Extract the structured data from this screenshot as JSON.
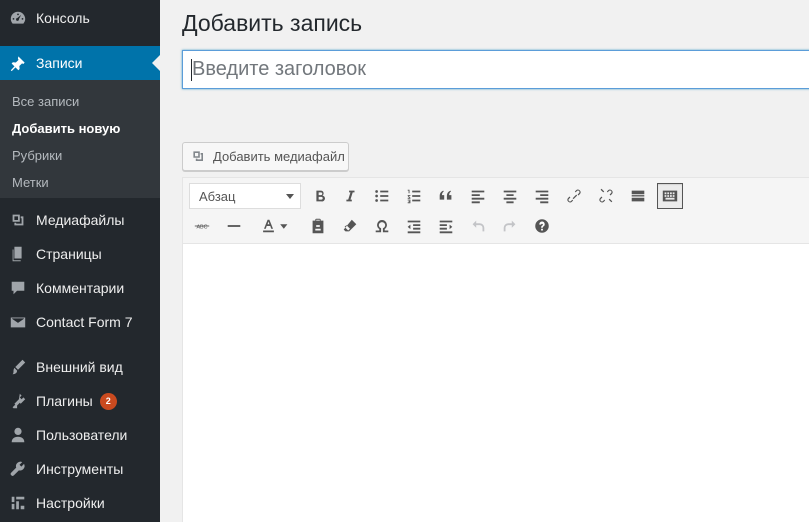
{
  "sidebar": {
    "items": [
      {
        "label": "Консоль",
        "icon": "dashboard-icon"
      },
      {
        "label": "Записи",
        "icon": "pin-icon",
        "active": true
      },
      {
        "label": "Медиафайлы",
        "icon": "media-icon"
      },
      {
        "label": "Страницы",
        "icon": "pages-icon"
      },
      {
        "label": "Комментарии",
        "icon": "comments-icon"
      },
      {
        "label": "Contact Form 7",
        "icon": "mail-icon"
      },
      {
        "label": "Внешний вид",
        "icon": "brush-icon"
      },
      {
        "label": "Плагины",
        "icon": "plugins-icon",
        "badge": "2"
      },
      {
        "label": "Пользователи",
        "icon": "users-icon"
      },
      {
        "label": "Инструменты",
        "icon": "wrench-icon"
      },
      {
        "label": "Настройки",
        "icon": "settings-icon"
      }
    ],
    "submenu": [
      {
        "label": "Все записи"
      },
      {
        "label": "Добавить новую",
        "current": true
      },
      {
        "label": "Рубрики"
      },
      {
        "label": "Метки"
      }
    ]
  },
  "main": {
    "page_title": "Добавить запись",
    "title_placeholder": "Введите заголовок",
    "add_media_label": "Добавить медиафайл",
    "format_select": "Абзац"
  },
  "colors": {
    "sidebar_bg": "#23282d",
    "accent": "#0073aa",
    "badge": "#ca4a1f"
  }
}
